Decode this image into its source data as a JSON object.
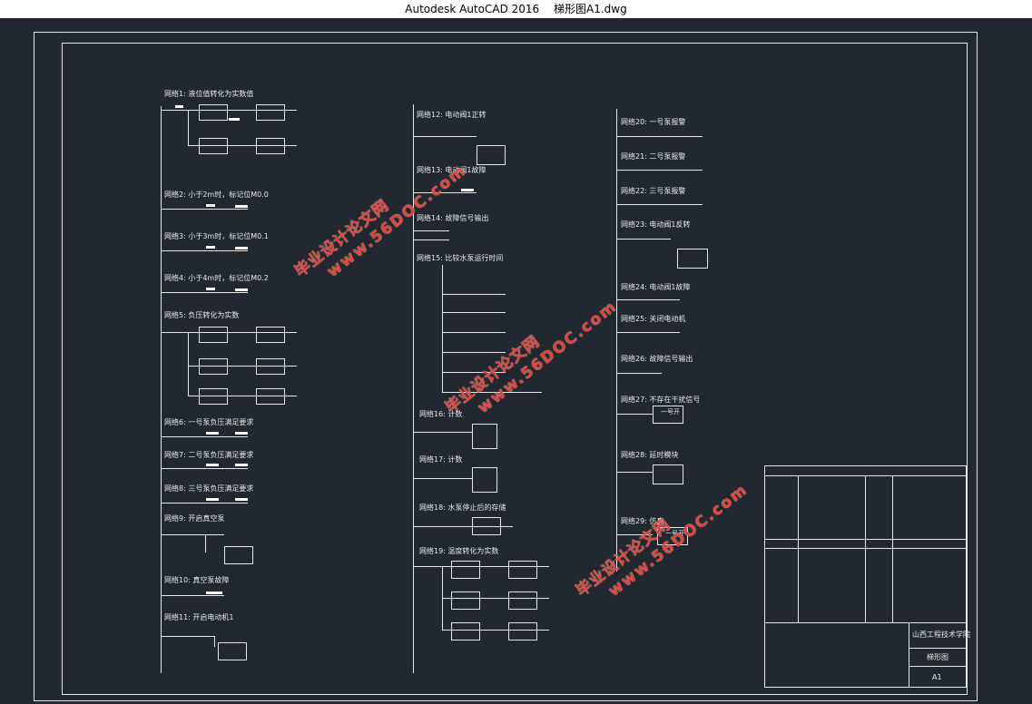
{
  "window": {
    "app_title": "Autodesk AutoCAD 2016",
    "file_name": "梯形图A1.dwg"
  },
  "column1": [
    {
      "label": "网络1: 液位值转化为实数值"
    },
    {
      "label": "网络2: 小于2m时，标记位M0.0"
    },
    {
      "label": "网络3: 小于3m时，标记位M0.1"
    },
    {
      "label": "网络4: 小于4m时，标记位M0.2"
    },
    {
      "label": "网络5: 负压转化为实数"
    },
    {
      "label": "网络6: 一号泵负压满足要求"
    },
    {
      "label": "网络7: 二号泵负压满足要求"
    },
    {
      "label": "网络8: 三号泵负压满足要求"
    },
    {
      "label": "网络9: 开启真空泵"
    },
    {
      "label": "网络10: 真空泵故障"
    },
    {
      "label": "网络11: 开启电动机1"
    }
  ],
  "column2": [
    {
      "label": "网络12: 电动阀1正转"
    },
    {
      "label": "网络13: 电动阀1故障"
    },
    {
      "label": "网络14: 故障信号输出"
    },
    {
      "label": "网络15: 比较水泵运行时间"
    },
    {
      "label": "网络16: 计数"
    },
    {
      "label": "网络17: 计数"
    },
    {
      "label": "网络18: 水泵停止后的存储"
    },
    {
      "label": "网络19: 温度转化为实数"
    }
  ],
  "column3": [
    {
      "label": "网络20: 一号泵报警"
    },
    {
      "label": "网络21: 二号泵报警"
    },
    {
      "label": "网络22: 三号泵报警"
    },
    {
      "label": "网络23: 电动阀1反转"
    },
    {
      "label": "网络24: 电动阀1故障"
    },
    {
      "label": "网络25: 关闭电动机"
    },
    {
      "label": "网络26: 故障信号输出"
    },
    {
      "label": "网络27: 不存在干扰信号"
    },
    {
      "label": "网络28: 延时模块"
    },
    {
      "label": "网络29: 仿真"
    }
  ],
  "blocks": {
    "single_box_label": "一号开"
  },
  "watermarks": [
    {
      "line1": "毕业设计论文网",
      "line2": "www.56DOC.com"
    },
    {
      "line1": "毕业设计论文网",
      "line2": "www.56DOC.com"
    },
    {
      "line1": "毕业设计论文网",
      "line2": "www.56DOC.com"
    }
  ],
  "title_block": {
    "school": "山西工程技术学院",
    "drawing_name": "梯形图",
    "sheet": "A1"
  },
  "colors": {
    "background": "#212830",
    "lines": "#e8e8e8",
    "watermark": "#e0453a"
  }
}
